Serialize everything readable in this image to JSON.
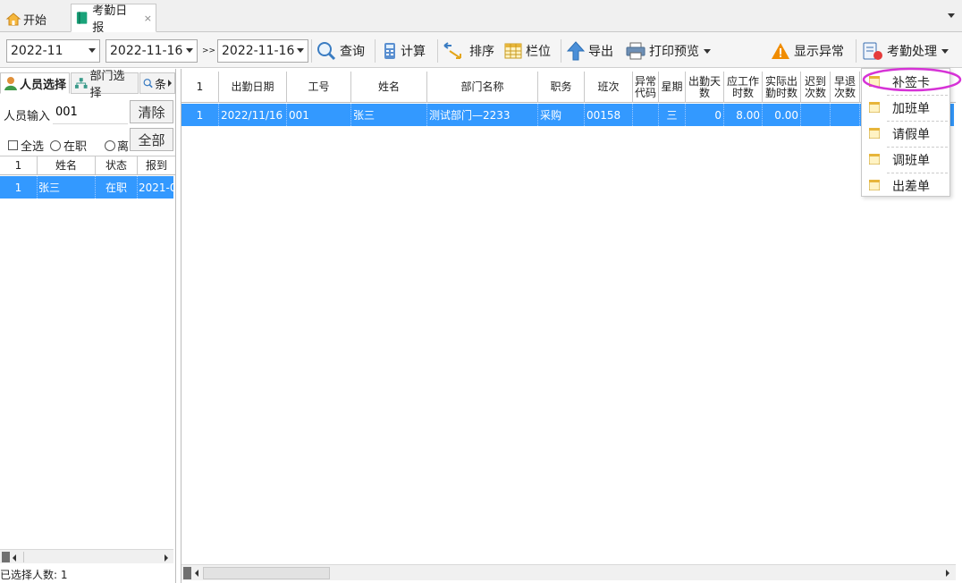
{
  "tabs": [
    {
      "label": "开始",
      "icon": "home-icon"
    },
    {
      "label": "考勤日报",
      "icon": "book-icon",
      "close": "×"
    }
  ],
  "toolbar": {
    "month": "2022-11",
    "date_from": "2022-11-16",
    "range_sep": ">>",
    "date_to": "2022-11-16",
    "query_label": "查询",
    "calc_label": "计算",
    "sort_label": "排序",
    "columns_label": "栏位",
    "export_label": "导出",
    "print_preview_label": "打印预览",
    "show_abnormal_label": "显示异常",
    "attendance_process_label": "考勤处理"
  },
  "left_panel": {
    "tabs": [
      "人员选择",
      "部门选择",
      "条"
    ],
    "person_input_label": "人员输入",
    "person_input_value": "001",
    "clear_label": "清除",
    "all_button_label": "全部",
    "select_all_label": "全选",
    "filter_active_label": "在职",
    "filter_left_label": "离",
    "grid": {
      "headers": [
        "1",
        "姓名",
        "状态",
        "报到"
      ],
      "rows": [
        [
          "1",
          "张三",
          "在职",
          "2021-0"
        ]
      ]
    },
    "selected_count_label": "已选择人数: 1"
  },
  "main_grid": {
    "headers": [
      "1",
      "出勤日期",
      "工号",
      "姓名",
      "部门名称",
      "职务",
      "班次",
      "异常代码",
      "星期",
      "出勤天数",
      "应工作时数",
      "实际出勤时数",
      "迟到次数",
      "早退次数"
    ],
    "header_display": [
      "1",
      "出勤日期",
      "工号",
      "姓名",
      "部门名称",
      "职务",
      "班次",
      "异常\n代码",
      "星期",
      "出勤天\n数",
      "应工作\n时数",
      "实际出\n勤时数",
      "迟到\n次数",
      "早退\n次数"
    ],
    "rows": [
      [
        "1",
        "2022/11/16",
        "001",
        "张三",
        "测试部门—2233",
        "采购",
        "00158",
        "",
        "三",
        "0",
        "8.00",
        "0.00",
        "",
        ""
      ]
    ]
  },
  "dropdown_menu": {
    "items": [
      "补签卡",
      "加班单",
      "请假单",
      "调班单",
      "出差单"
    ],
    "highlight_color": "#d633d6"
  },
  "colors": {
    "selection": "#3399ff",
    "accent_orange": "#f08c00"
  }
}
